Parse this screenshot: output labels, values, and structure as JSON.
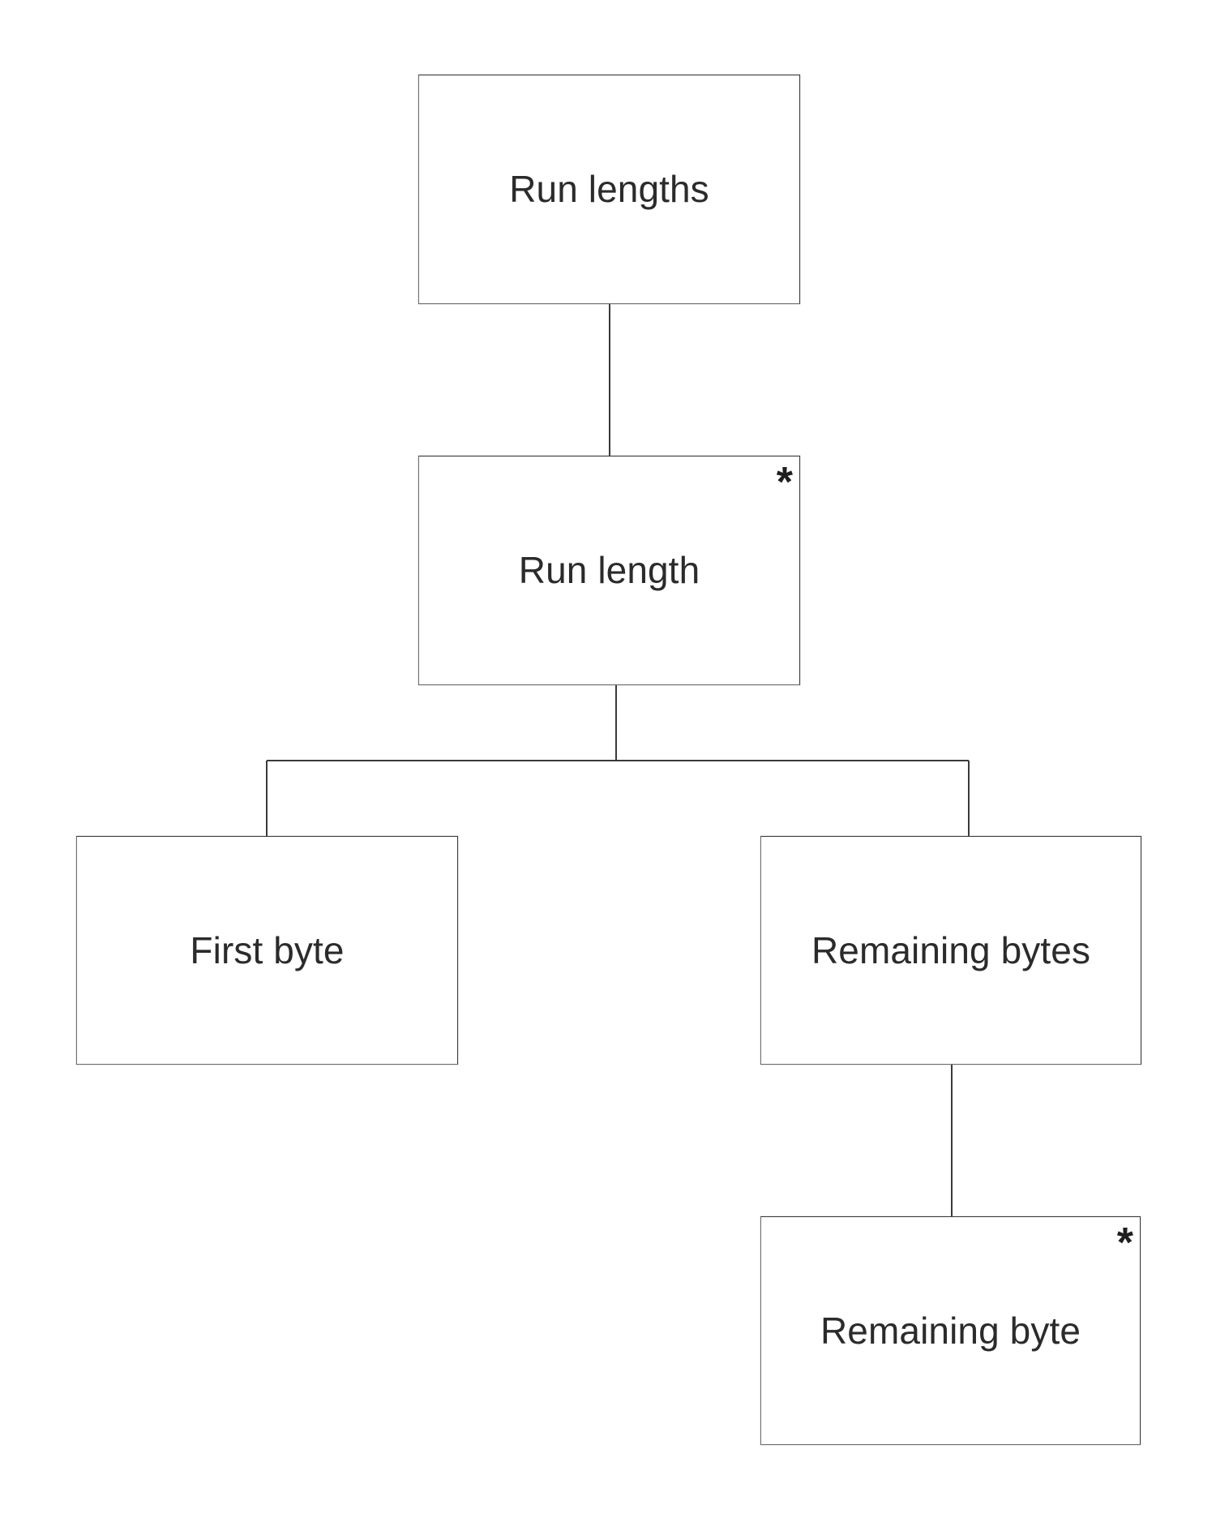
{
  "diagram": {
    "title": "Run lengths",
    "type": "decomposition-tree",
    "background_color": "#ffffff",
    "line_color": "#3a3a3a",
    "box_border_color": "#6f6f6f",
    "text_color": "#2b2b2b",
    "multiplicity_symbol": "*",
    "nodes": [
      {
        "id": "run-lengths",
        "label": "Run lengths",
        "multiplicity": "",
        "level": 0
      },
      {
        "id": "run-length",
        "label": "Run length",
        "multiplicity": "*",
        "level": 1
      },
      {
        "id": "first-byte",
        "label": "First byte",
        "multiplicity": "",
        "level": 2
      },
      {
        "id": "remaining-bytes",
        "label": "Remaining bytes",
        "multiplicity": "",
        "level": 2
      },
      {
        "id": "remaining-byte",
        "label": "Remaining byte",
        "multiplicity": "*",
        "level": 3
      }
    ],
    "edges": [
      {
        "from": "run-lengths",
        "to": "run-length"
      },
      {
        "from": "run-length",
        "to": "first-byte"
      },
      {
        "from": "run-length",
        "to": "remaining-bytes"
      },
      {
        "from": "remaining-bytes",
        "to": "remaining-byte"
      }
    ]
  }
}
